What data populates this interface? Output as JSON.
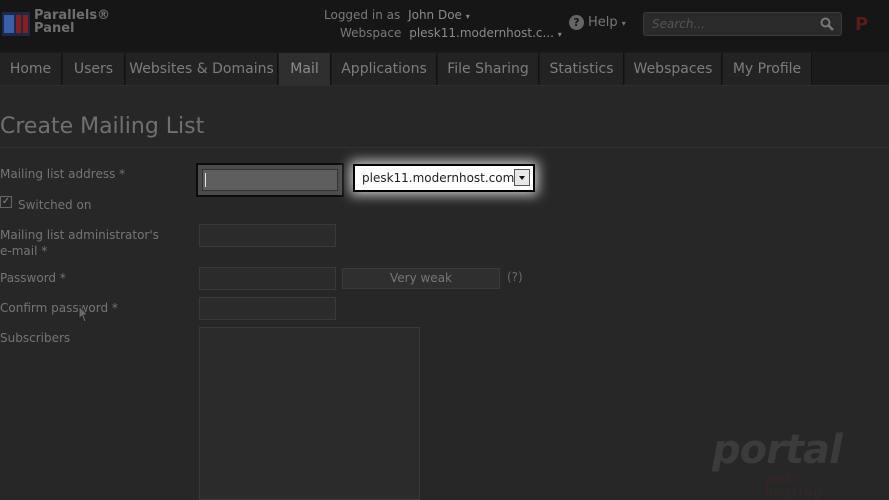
{
  "header": {
    "logo_line1": "Parallels®",
    "logo_line2": "Panel",
    "logged_in_label": "Logged in as",
    "user": "John Doe",
    "webspace_label": "Webspace",
    "webspace_value": "plesk11.modernhost.c...",
    "help_label": "Help",
    "search_placeholder": "Search...",
    "corner_logo": "P"
  },
  "tabs": [
    {
      "label": "Home"
    },
    {
      "label": "Users"
    },
    {
      "label": "Websites & Domains"
    },
    {
      "label": "Mail",
      "active": true
    },
    {
      "label": "Applications"
    },
    {
      "label": "File Sharing"
    },
    {
      "label": "Statistics"
    },
    {
      "label": "Webspaces"
    },
    {
      "label": "My Profile"
    }
  ],
  "page": {
    "title": "Create Mailing List"
  },
  "form": {
    "address_label": "Mailing list address *",
    "address_value": "",
    "domain_selected": "plesk11.modernhost.com",
    "switched_on_label": "Switched on",
    "switched_on_checked": true,
    "admin_email_label_line1": "Mailing list administrator's",
    "admin_email_label_line2": "e-mail *",
    "password_label": "Password *",
    "password_strength": "Very weak",
    "password_help": "(?)",
    "confirm_password_label": "Confirm password *",
    "subscribers_label": "Subscribers"
  },
  "watermark": {
    "brand": "portal",
    "tagline": "web hosting"
  }
}
